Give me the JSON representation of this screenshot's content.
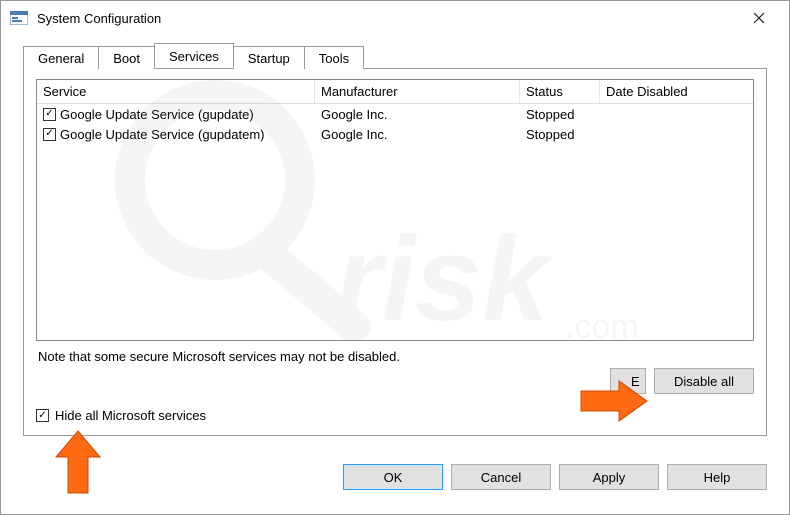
{
  "window": {
    "title": "System Configuration"
  },
  "tabs": {
    "general": "General",
    "boot": "Boot",
    "services": "Services",
    "startup": "Startup",
    "tools": "Tools"
  },
  "columns": {
    "service": "Service",
    "mfr": "Manufacturer",
    "status": "Status",
    "date": "Date Disabled"
  },
  "services": [
    {
      "name": "Google Update Service (gupdate)",
      "mfr": "Google Inc.",
      "status": "Stopped",
      "checked": true
    },
    {
      "name": "Google Update Service (gupdatem)",
      "mfr": "Google Inc.",
      "status": "Stopped",
      "checked": true
    }
  ],
  "note": "Note that some secure Microsoft services may not be disabled.",
  "buttons": {
    "enable_all": "E",
    "disable_all": "Disable all",
    "ok": "OK",
    "cancel": "Cancel",
    "apply": "Apply",
    "help": "Help"
  },
  "hide_checkbox": {
    "label": "Hide all Microsoft services",
    "checked": true
  }
}
